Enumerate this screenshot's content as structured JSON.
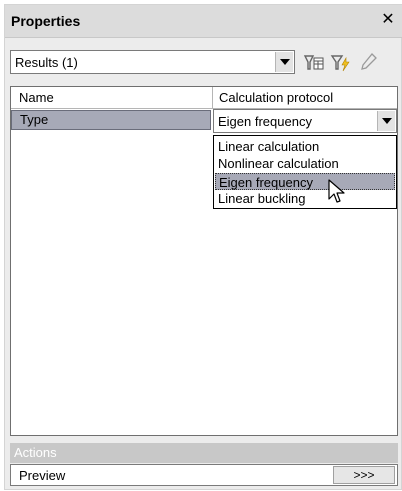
{
  "panel": {
    "title": "Properties",
    "close_symbol": "✕"
  },
  "toolbar": {
    "combo_value": "Results (1)",
    "icons": [
      "filter-table-icon",
      "filter-lightning-icon",
      "pencil-icon"
    ]
  },
  "grid": {
    "headers": [
      "Name",
      "Calculation protocol"
    ],
    "row": {
      "name": "Type",
      "value": "Eigen frequency"
    },
    "dropdown_options": [
      "Linear calculation",
      "Nonlinear calculation",
      "Eigen frequency",
      "Linear buckling"
    ],
    "selected_option": "Eigen frequency"
  },
  "actions": {
    "header": "Actions",
    "items": [
      {
        "label": "Preview",
        "button": ">>>"
      }
    ]
  },
  "colors": {
    "selection": "#a7a9b7",
    "panel_bg": "#ececec",
    "title_bg": "#dcdcdc"
  }
}
